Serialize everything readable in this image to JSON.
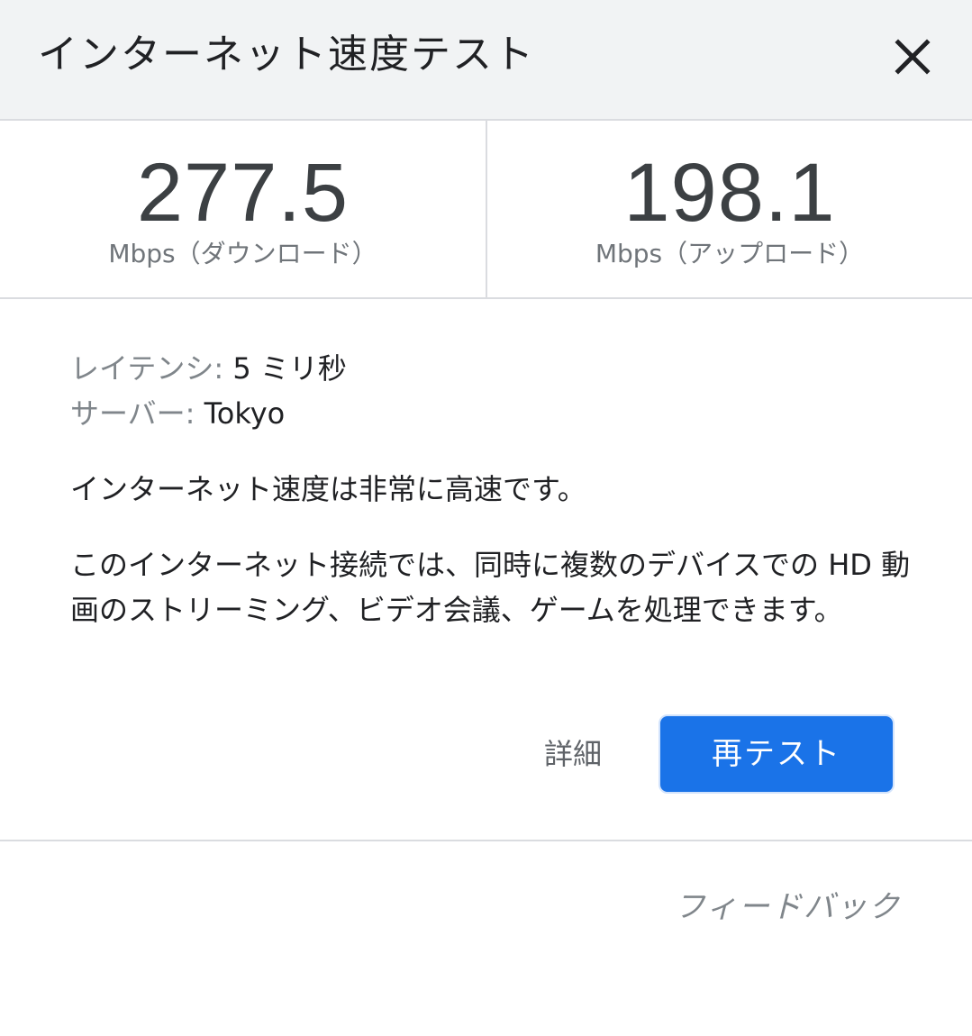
{
  "header": {
    "title": "インターネット速度テスト",
    "close_icon": "close-icon"
  },
  "stats": {
    "download": {
      "value": "277.5",
      "unit": "Mbps（ダウンロード）"
    },
    "upload": {
      "value": "198.1",
      "unit": "Mbps（アップロード）"
    }
  },
  "details": {
    "latency_label": "レイテンシ:",
    "latency_value": "5 ミリ秒",
    "server_label": "サーバー:",
    "server_value": "Tokyo"
  },
  "summary": "インターネット速度は非常に高速です。",
  "description": "このインターネット接続では、同時に複数のデバイスでの HD 動画のストリーミング、ビデオ会議、ゲームを処理できます。",
  "actions": {
    "details_label": "詳細",
    "retest_label": "再テスト"
  },
  "footer": {
    "feedback_label": "フィードバック"
  },
  "colors": {
    "header_bg": "#f1f3f4",
    "accent": "#1a73e8",
    "divider": "#dadce0",
    "secondary_text": "#80868b"
  }
}
